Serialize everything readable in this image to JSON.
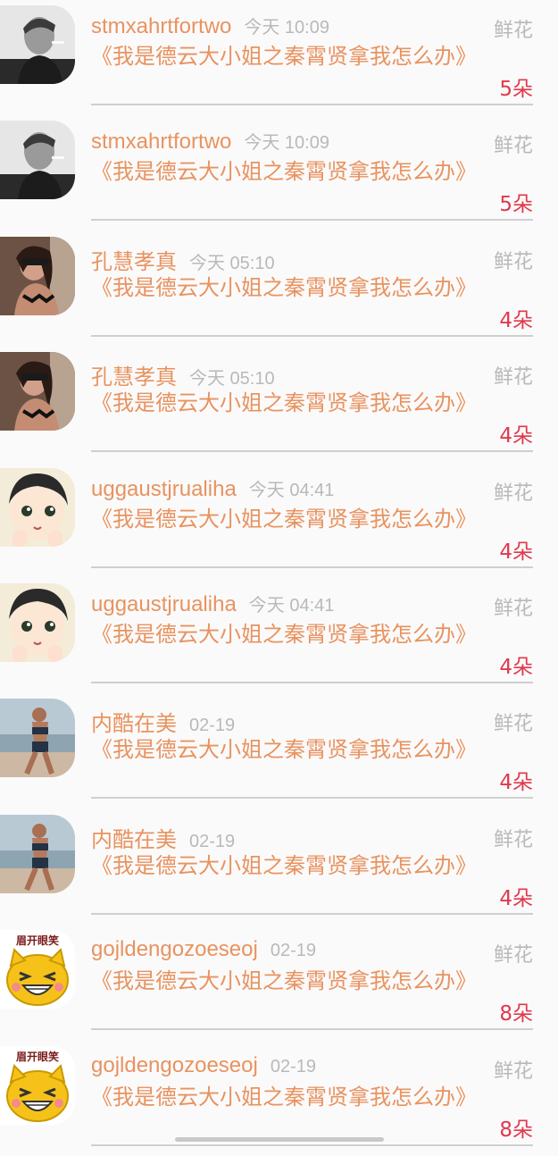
{
  "list": {
    "items": [
      {
        "name": "stmxahrtfortwo",
        "time": "今天 10:09",
        "gift": "鲜花",
        "title": "《我是德云大小姐之秦霄贤拿我怎么办》",
        "count": "5朵",
        "avatar": "man"
      },
      {
        "name": "stmxahrtfortwo",
        "time": "今天 10:09",
        "gift": "鲜花",
        "title": "《我是德云大小姐之秦霄贤拿我怎么办》",
        "count": "5朵",
        "avatar": "man"
      },
      {
        "name": "孔慧孝真",
        "time": "今天 05:10",
        "gift": "鲜花",
        "title": "《我是德云大小姐之秦霄贤拿我怎么办》",
        "count": "4朵",
        "avatar": "woman"
      },
      {
        "name": "孔慧孝真",
        "time": "今天 05:10",
        "gift": "鲜花",
        "title": "《我是德云大小姐之秦霄贤拿我怎么办》",
        "count": "4朵",
        "avatar": "woman"
      },
      {
        "name": "uggaustjrualiha",
        "time": "今天 04:41",
        "gift": "鲜花",
        "title": "《我是德云大小姐之秦霄贤拿我怎么办》",
        "count": "4朵",
        "avatar": "anime"
      },
      {
        "name": "uggaustjrualiha",
        "time": "今天 04:41",
        "gift": "鲜花",
        "title": "《我是德云大小姐之秦霄贤拿我怎么办》",
        "count": "4朵",
        "avatar": "anime"
      },
      {
        "name": "内酷在美",
        "time": "02-19",
        "gift": "鲜花",
        "title": "《我是德云大小姐之秦霄贤拿我怎么办》",
        "count": "4朵",
        "avatar": "runner"
      },
      {
        "name": "内酷在美",
        "time": "02-19",
        "gift": "鲜花",
        "title": "《我是德云大小姐之秦霄贤拿我怎么办》",
        "count": "4朵",
        "avatar": "runner"
      },
      {
        "name": "gojldengozoeseoj",
        "time": "02-19",
        "gift": "鲜花",
        "title": "《我是德云大小姐之秦霄贤拿我怎么办》",
        "count": "8朵",
        "avatar": "cat",
        "avatar_text": "眉开眼笑"
      },
      {
        "name": "gojldengozoeseoj",
        "time": "02-19",
        "gift": "鲜花",
        "title": "《我是德云大小姐之秦霄贤拿我怎么办》",
        "count": "8朵",
        "avatar": "cat",
        "avatar_text": "眉开眼笑"
      }
    ]
  },
  "colors": {
    "name": "#e8935f",
    "count": "#e0394c",
    "muted": "#b9b9b9"
  }
}
